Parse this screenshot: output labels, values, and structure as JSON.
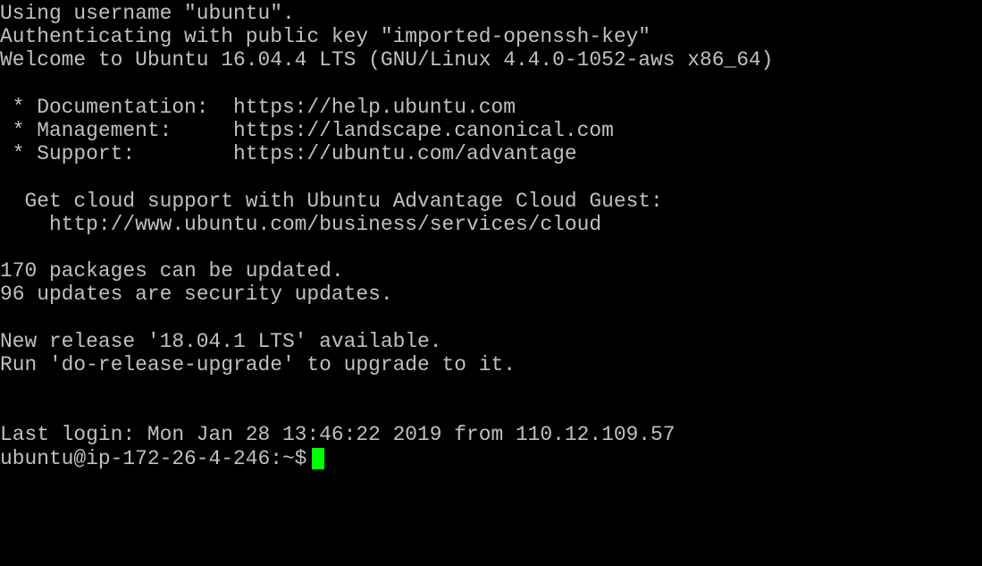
{
  "terminal": {
    "lines": [
      "Using username \"ubuntu\".",
      "Authenticating with public key \"imported-openssh-key\"",
      "Welcome to Ubuntu 16.04.4 LTS (GNU/Linux 4.4.0-1052-aws x86_64)",
      "",
      " * Documentation:  https://help.ubuntu.com",
      " * Management:     https://landscape.canonical.com",
      " * Support:        https://ubuntu.com/advantage",
      "",
      "  Get cloud support with Ubuntu Advantage Cloud Guest:",
      "    http://www.ubuntu.com/business/services/cloud",
      "",
      "170 packages can be updated.",
      "96 updates are security updates.",
      "",
      "New release '18.04.1 LTS' available.",
      "Run 'do-release-upgrade' to upgrade to it.",
      "",
      "",
      "Last login: Mon Jan 28 13:46:22 2019 from 110.12.109.57"
    ],
    "prompt": "ubuntu@ip-172-26-4-246:~$",
    "cursor_color": "#00ff00",
    "text_color": "#c0c0c0",
    "background_color": "#000000"
  }
}
